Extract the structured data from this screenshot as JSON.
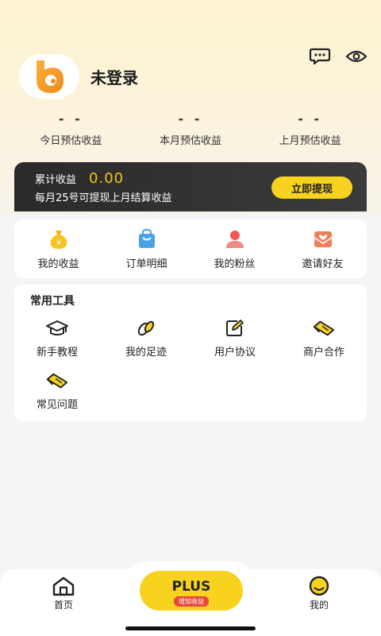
{
  "profile": {
    "username": "未登录"
  },
  "stats": [
    {
      "value": "- -",
      "label": "今日预估收益"
    },
    {
      "value": "- -",
      "label": "本月预估收益"
    },
    {
      "value": "- -",
      "label": "上月预估收益"
    }
  ],
  "earnings": {
    "label": "累计收益",
    "value": "0.00",
    "note": "每月25号可提现上月结算收益",
    "withdraw_label": "立即提现"
  },
  "menu": [
    {
      "label": "我的收益",
      "icon": "money-bag-icon"
    },
    {
      "label": "订单明细",
      "icon": "shopping-bag-icon"
    },
    {
      "label": "我的粉丝",
      "icon": "fans-icon"
    },
    {
      "label": "邀请好友",
      "icon": "invite-envelope-icon"
    }
  ],
  "tools": {
    "title": "常用工具",
    "items": [
      {
        "label": "新手教程",
        "icon": "graduation-cap-icon"
      },
      {
        "label": "我的足迹",
        "icon": "footprint-icon"
      },
      {
        "label": "用户协议",
        "icon": "edit-document-icon"
      },
      {
        "label": "商户合作",
        "icon": "handshake-icon"
      },
      {
        "label": "常见问题",
        "icon": "handshake-icon"
      }
    ]
  },
  "bottom_nav": {
    "home_label": "首页",
    "plus_label": "PLUS",
    "plus_badge": "增加收益",
    "mine_label": "我的"
  },
  "colors": {
    "accent": "#f7d31f",
    "card_dark": "#2e2e2e",
    "badge_red": "#e8493c"
  }
}
